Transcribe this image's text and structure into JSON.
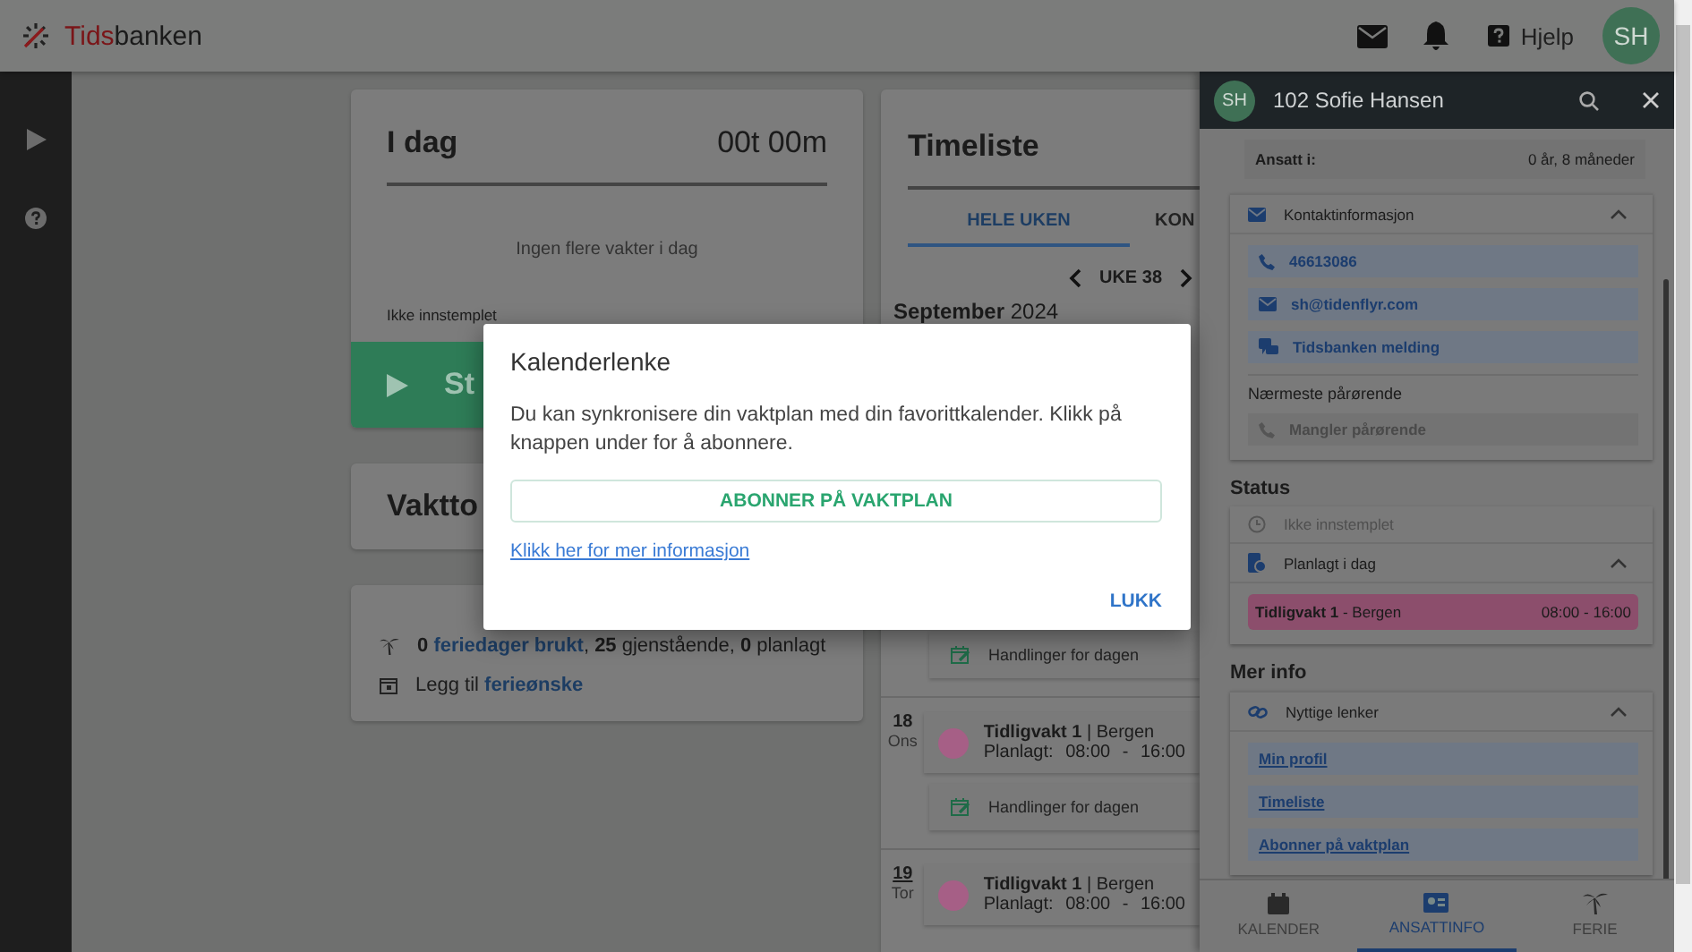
{
  "header": {
    "logo": "Tidsbanken",
    "help": "Hjelp",
    "avatar": "SH"
  },
  "today_card": {
    "title": "I dag",
    "hours": "00t 00m",
    "empty": "Ingen flere vakter i dag",
    "status": "Ikke innstemplet",
    "start_button": "St"
  },
  "shift_card": {
    "title": "Vaktto"
  },
  "vacation_card": {
    "summary": [
      {
        "text": "0",
        "kind": "strong"
      },
      {
        "text": "feriedager brukt",
        "kind": "link"
      },
      {
        "text": ",",
        "kind": "plain",
        "attached": true
      },
      {
        "text": "25",
        "kind": "strong"
      },
      {
        "text": "gjenstående,",
        "kind": "plain"
      },
      {
        "text": "0",
        "kind": "strong"
      },
      {
        "text": "planlagt",
        "kind": "plain"
      }
    ],
    "add": [
      {
        "text": "Legg til",
        "kind": "plain"
      },
      {
        "text": "ferieønske",
        "kind": "link"
      }
    ]
  },
  "timesheet": {
    "title": "Timeliste",
    "tabs": [
      {
        "label": "HELE UKEN",
        "selected": true
      },
      {
        "label": "KON",
        "selected": false
      }
    ],
    "week": "UKE 38",
    "month": "September",
    "year": "2024",
    "entries": [
      {
        "kind": "actions",
        "label": "Handlinger for dagen"
      },
      {
        "kind": "day",
        "day": "18",
        "weekday": "Ons",
        "today": false,
        "shift": "Tidligvakt 1",
        "separator": "|",
        "place": "Bergen",
        "planned_label": "Planlagt:",
        "time": "08:00 - 16:00",
        "color": "#a65f86"
      },
      {
        "kind": "actions",
        "label": "Handlinger for dagen"
      },
      {
        "kind": "day",
        "day": "19",
        "weekday": "Tor",
        "today": true,
        "shift": "Tidligvakt 1",
        "separator": "|",
        "place": "Bergen",
        "planned_label": "Planlagt:",
        "time": "08:00 - 16:00",
        "color": "#a65f86"
      }
    ]
  },
  "panel": {
    "avatar": "SH",
    "title": "102 Sofie Hansen",
    "employed_label": "Ansatt i:",
    "employed_value": "0 år, 8 måneder",
    "contact": {
      "title": "Kontaktinformasjon",
      "expanded": true,
      "items": [
        {
          "kind": "phone",
          "text": "46613086"
        },
        {
          "kind": "email",
          "text": "sh@tidenflyr.com"
        },
        {
          "kind": "message",
          "text": "Tidsbanken melding"
        }
      ],
      "relatives_label": "Nærmeste pårørende",
      "relatives_missing": "Mangler pårørende"
    },
    "status": {
      "heading": "Status",
      "clock": "Ikke innstemplet",
      "planned": {
        "title": "Planlagt i dag",
        "expanded": true
      },
      "shift": {
        "name": "Tidligvakt 1",
        "place": "- Bergen",
        "time": "08:00 - 16:00",
        "color": "#8c4e6c"
      }
    },
    "more": {
      "heading": "Mer info",
      "title": "Nyttige lenker",
      "expanded": true,
      "links": [
        "Min profil",
        "Timeliste",
        "Abonner på vaktplan"
      ]
    },
    "nav": [
      {
        "label": "KALENDER",
        "selected": false
      },
      {
        "label": "ANSATTINFO",
        "selected": true
      },
      {
        "label": "FERIE",
        "selected": false
      }
    ]
  },
  "modal": {
    "title": "Kalenderlenke",
    "text": "Du kan synkronisere din vaktplan med din favorittkalender. Klikk på knappen under for å abonnere.",
    "button": "ABONNER PÅ VAKTPLAN",
    "link": "Klikk her for mer informasjon",
    "close": "LUKK"
  }
}
